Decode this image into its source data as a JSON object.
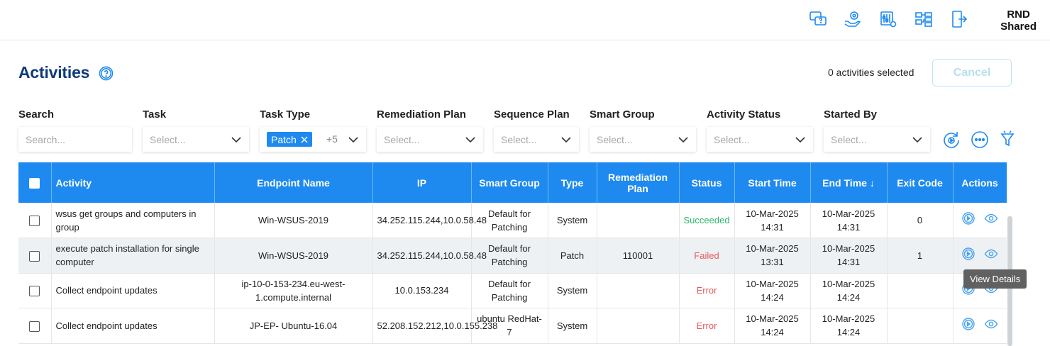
{
  "header": {
    "org_line1": "RND",
    "org_line2": "Shared",
    "icons": [
      "help-chat-icon",
      "managed-services-icon",
      "settings-sliders-icon",
      "network-diagram-icon",
      "logout-icon"
    ]
  },
  "page": {
    "title": "Activities",
    "selected_count": "0 activities selected",
    "cancel_label": "Cancel"
  },
  "filters": {
    "search": {
      "label": "Search",
      "placeholder": "Search..."
    },
    "task": {
      "label": "Task",
      "placeholder": "Select..."
    },
    "task_type": {
      "label": "Task Type",
      "chip": "Patch",
      "more": "+5"
    },
    "remediation_plan": {
      "label": "Remediation Plan",
      "placeholder": "Select..."
    },
    "sequence_plan": {
      "label": "Sequence Plan",
      "placeholder": "Select..."
    },
    "smart_group": {
      "label": "Smart Group",
      "placeholder": "Select..."
    },
    "activity_status": {
      "label": "Activity Status",
      "placeholder": "Select..."
    },
    "started_by": {
      "label": "Started By",
      "placeholder": "Select..."
    },
    "action_icons": [
      "refresh-icon",
      "more-options-icon",
      "clear-filter-icon"
    ]
  },
  "table": {
    "columns": {
      "activity": "Activity",
      "endpoint": "Endpoint Name",
      "ip": "IP",
      "smart_group": "Smart Group",
      "type": "Type",
      "remediation_plan": "Remediation Plan",
      "status": "Status",
      "start_time": "Start Time",
      "end_time": "End Time",
      "exit_code": "Exit Code",
      "actions": "Actions"
    },
    "sort_indicator": "↓",
    "rows": [
      {
        "activity": "wsus get groups and computers in group",
        "endpoint": "Win-WSUS-2019",
        "ip": "34.252.115.244,10.0.58.48",
        "smart_group": "Default for Patching",
        "type": "System",
        "remediation_plan": "",
        "status": "Succeeded",
        "start_time": "10-Mar-2025 14:31",
        "end_time": "10-Mar-2025 14:31",
        "exit_code": "0"
      },
      {
        "activity": "execute patch installation for single computer",
        "endpoint": "Win-WSUS-2019",
        "ip": "34.252.115.244,10.0.58.48",
        "smart_group": "Default for Patching",
        "type": "Patch",
        "remediation_plan": "110001",
        "status": "Failed",
        "start_time": "10-Mar-2025 13:31",
        "end_time": "10-Mar-2025 14:31",
        "exit_code": "1"
      },
      {
        "activity": "Collect endpoint updates",
        "endpoint": "ip-10-0-153-234.eu-west-1.compute.internal",
        "ip": "10.0.153.234",
        "smart_group": "Default for Patching",
        "type": "System",
        "remediation_plan": "",
        "status": "Error",
        "start_time": "10-Mar-2025 14:24",
        "end_time": "10-Mar-2025 14:24",
        "exit_code": ""
      },
      {
        "activity": "Collect endpoint updates",
        "endpoint": "JP-EP- Ubuntu-16.04",
        "ip": "52.208.152.212,10.0.155.238",
        "smart_group": "ubuntu RedHat-7",
        "type": "System",
        "remediation_plan": "",
        "status": "Error",
        "start_time": "10-Mar-2025 14:24",
        "end_time": "10-Mar-2025 14:24",
        "exit_code": ""
      }
    ]
  },
  "tooltip": "View Details",
  "colors": {
    "accent": "#1e8af0",
    "title": "#0d3a7a",
    "success": "#2db56c",
    "failure": "#e35a5a"
  }
}
